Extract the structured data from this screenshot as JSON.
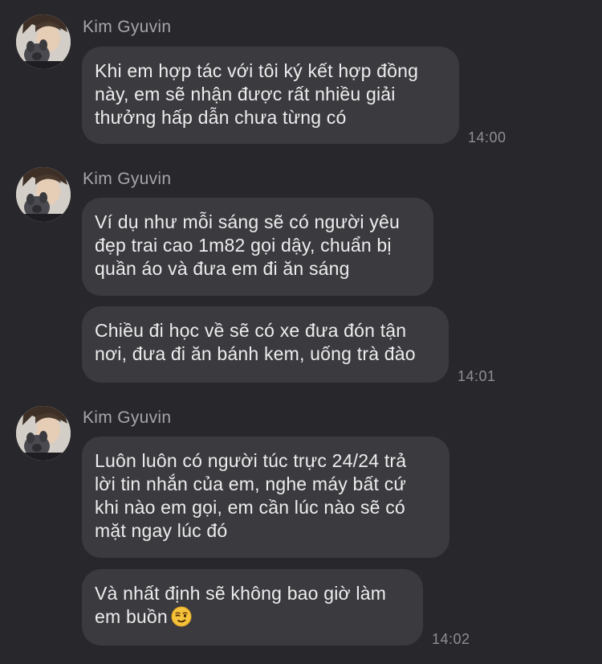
{
  "messages": [
    {
      "sender": "Kim Gyuvin",
      "bubbles": [
        {
          "lines": [
            "Khi em hợp tác với tôi ký kết hợp đồng",
            "này, em sẽ nhận được rất nhiều giải",
            "thưởng hấp dẫn chưa từng có"
          ]
        }
      ],
      "time": "14:00"
    },
    {
      "sender": "Kim Gyuvin",
      "bubbles": [
        {
          "lines": [
            "Ví dụ như mỗi sáng sẽ có người yêu",
            "đẹp trai cao 1m82 gọi dậy, chuẩn bị",
            "quần áo và đưa em đi ăn sáng"
          ]
        },
        {
          "lines": [
            "Chiều đi học về sẽ có xe đưa đón tận",
            "nơi, đưa đi ăn bánh kem, uống trà đào"
          ]
        }
      ],
      "time": "14:01"
    },
    {
      "sender": "Kim Gyuvin",
      "bubbles": [
        {
          "lines": [
            "Luôn luôn có người túc trực 24/24 trả",
            "lời tin nhắn của em, nghe máy bất cứ",
            "khi nào em gọi, em cần lúc nào sẽ có",
            "mặt ngay lúc đó"
          ]
        },
        {
          "lines": [
            "Và nhất định sẽ không bao giờ làm",
            "em buồn"
          ],
          "emoji": "winking-face-emoji"
        }
      ],
      "time": "14:02"
    }
  ],
  "colors": {
    "background": "#28272b",
    "bubble": "#3b3a3f",
    "sender_name": "#a6a5aa",
    "timestamp": "#8f8e93",
    "emoji": "#f5c23b"
  }
}
